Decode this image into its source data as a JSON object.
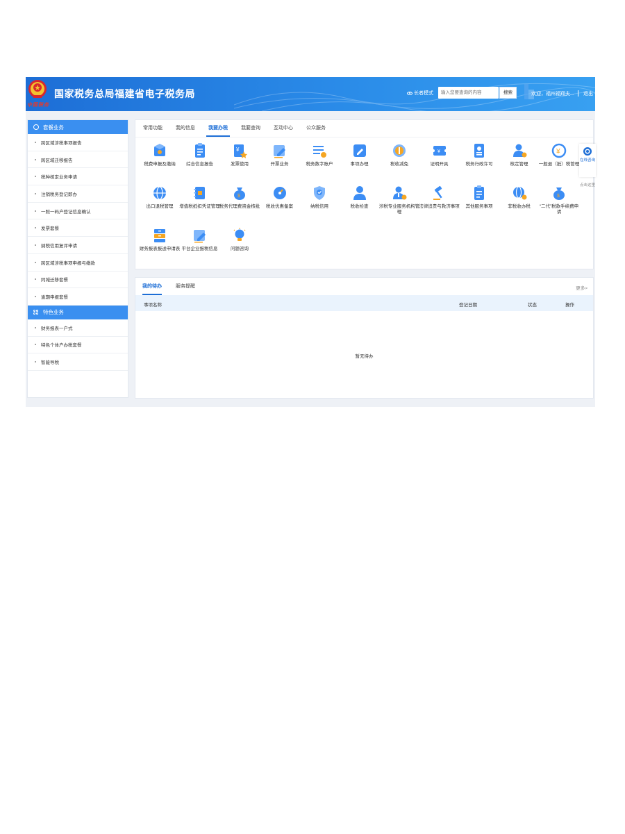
{
  "header": {
    "title": "国家税务总局福建省电子税务局",
    "logo_text": "中国税务",
    "elder_mode": "长者模式",
    "search_placeholder": "输入您要查询的内容",
    "search_button": "搜索",
    "welcome": "欢迎，福州福翔夫...",
    "logout": "退出"
  },
  "sidebar": {
    "section1_title": "套餐业务",
    "section1_items": [
      "跨区域涉税事项报告",
      "跨区域迁移报告",
      "税种核定业务申请",
      "注销税务登记即办",
      "一照一码户登记信息确认",
      "发票套餐",
      "纳税信用复评申请",
      "跨区域涉税事项申报与缴款",
      "同城迁移套餐",
      "逾期申报套餐"
    ],
    "section2_title": "特色业务",
    "section2_items": [
      "财务报表一户式",
      "特色个体户办税套餐",
      "智能导税"
    ]
  },
  "main": {
    "tabs": [
      "常用功能",
      "我的信息",
      "我要办税",
      "我要查询",
      "互动中心",
      "公众服务"
    ],
    "active_tab": 2,
    "functions": [
      {
        "label": "税费申报及缴纳",
        "icon": "box-icon"
      },
      {
        "label": "综合信息报告",
        "icon": "clipboard-icon"
      },
      {
        "label": "发票使用",
        "icon": "invoice-icon"
      },
      {
        "label": "开票业务",
        "icon": "edit-icon"
      },
      {
        "label": "税务数字账户",
        "icon": "list-icon"
      },
      {
        "label": "事项办理",
        "icon": "pen-icon"
      },
      {
        "label": "税收减免",
        "icon": "coin-icon"
      },
      {
        "label": "证明开具",
        "icon": "ticket-icon"
      },
      {
        "label": "税务行政许可",
        "icon": "id-card-icon"
      },
      {
        "label": "核定管理",
        "icon": "user-gear-icon"
      },
      {
        "label": "一般退（抵）税管理",
        "icon": "refund-icon"
      },
      {
        "label": "出口退税管理",
        "icon": "globe-icon"
      },
      {
        "label": "增值税抵扣凭证管理",
        "icon": "notebook-icon"
      },
      {
        "label": "税务代理费资金核批",
        "icon": "money-bag-icon"
      },
      {
        "label": "税收优惠备案",
        "icon": "gauge-icon"
      },
      {
        "label": "纳税信用",
        "icon": "shield-icon"
      },
      {
        "label": "税收检查",
        "icon": "person-icon"
      },
      {
        "label": "涉税专业服务机构管理",
        "icon": "agent-icon"
      },
      {
        "label": "法律追责与救济事项",
        "icon": "gavel-icon"
      },
      {
        "label": "其他服务事项",
        "icon": "clipboard-icon"
      },
      {
        "label": "非税收办税",
        "icon": "globe-user-icon"
      },
      {
        "label": "“二代”税款手续费申请",
        "icon": "money-bag-icon"
      },
      {
        "label": "财务报表报送申请表",
        "icon": "cabinet-icon"
      },
      {
        "label": "平台企业报税信息",
        "icon": "edit-icon"
      },
      {
        "label": "问题咨询",
        "icon": "bulb-icon"
      }
    ]
  },
  "todo": {
    "tabs": [
      "我的待办",
      "服务提醒"
    ],
    "more": "更多>",
    "columns": [
      "事项名称",
      "登记日期",
      "状态",
      "操作"
    ],
    "empty_text": "暂无待办"
  },
  "float": {
    "label": "在线咨询",
    "hint": "点击这里"
  },
  "colors": {
    "primary": "#1d6ed6",
    "sidebar_head": "#3a8ff0",
    "icon_blue": "#3c8df4",
    "icon_orange": "#f5a623"
  }
}
